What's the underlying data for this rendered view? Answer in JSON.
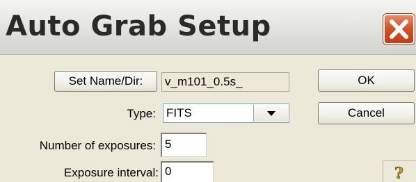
{
  "window": {
    "title": "Auto Grab Setup"
  },
  "buttons": {
    "set_name_dir": "Set Name/Dir:",
    "ok": "OK",
    "cancel": "Cancel"
  },
  "fields": {
    "name_value": "v_m101_0.5s_",
    "type_label": "Type:",
    "type_value": "FITS",
    "exposures_label": "Number of exposures:",
    "exposures_value": "5",
    "interval_label": "Exposure interval:",
    "interval_value": "0"
  },
  "icons": {
    "close": "close-icon",
    "help": "help-icon",
    "dropdown": "chevron-down-icon"
  },
  "colors": {
    "dialog_bg": "#ece9d8",
    "close_red": "#d2532f",
    "help_gold": "#c8a636"
  }
}
